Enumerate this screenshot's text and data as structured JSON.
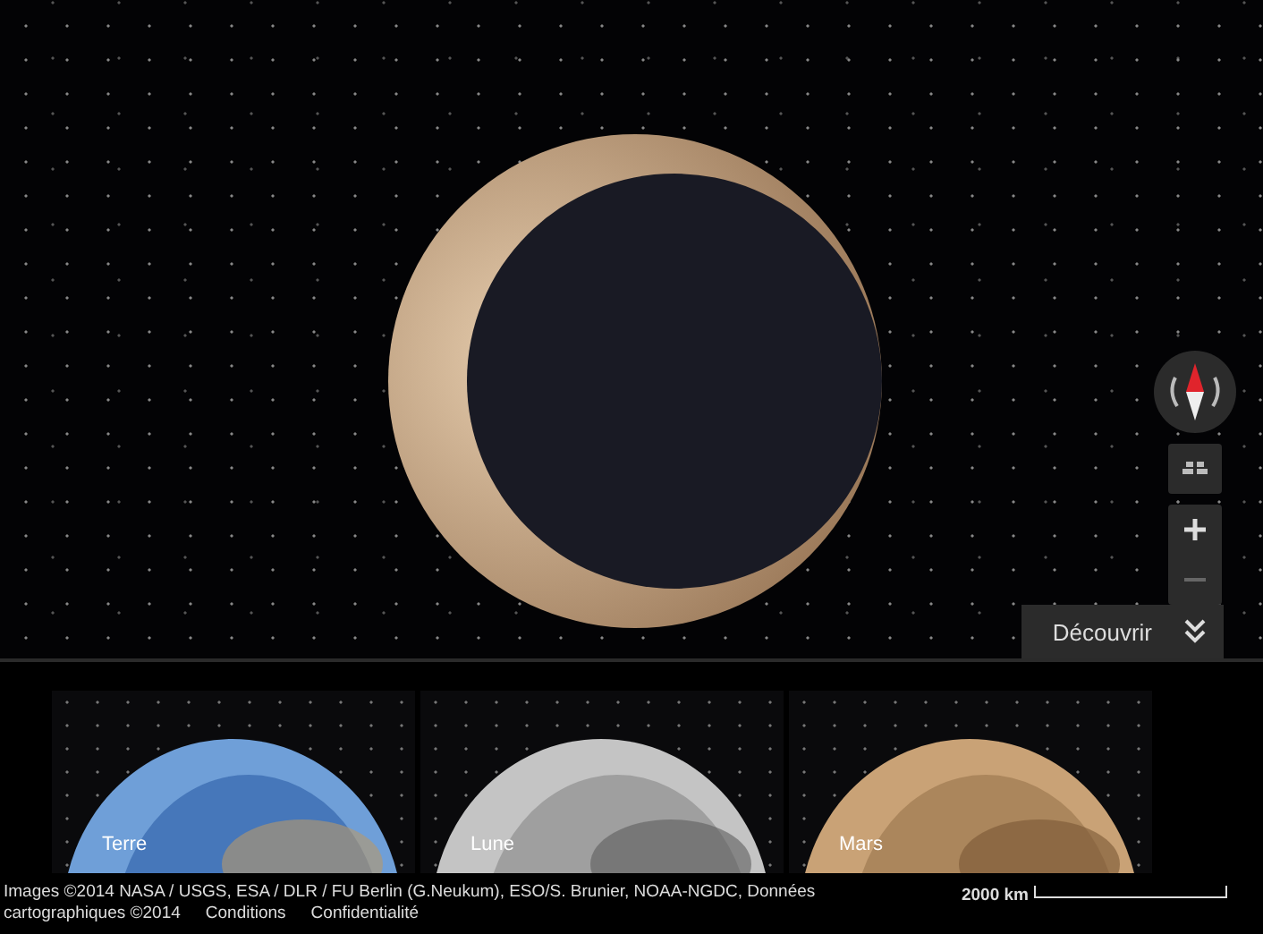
{
  "map_controls": {
    "discover_label": "Découvrir"
  },
  "planets": [
    {
      "name": "Terre",
      "kind": "earth"
    },
    {
      "name": "Lune",
      "kind": "moon"
    },
    {
      "name": "Mars",
      "kind": "mars"
    }
  ],
  "footer": {
    "attribution_lines": [
      "Images ©2014 NASA / USGS, ESA / DLR / FU Berlin (G.Neukum), ESO/S. Brunier, NOAA-NGDC, Données",
      "cartographiques ©2014"
    ],
    "links": [
      "Conditions",
      "Confidentialité"
    ],
    "scale_label": "2000 km"
  }
}
